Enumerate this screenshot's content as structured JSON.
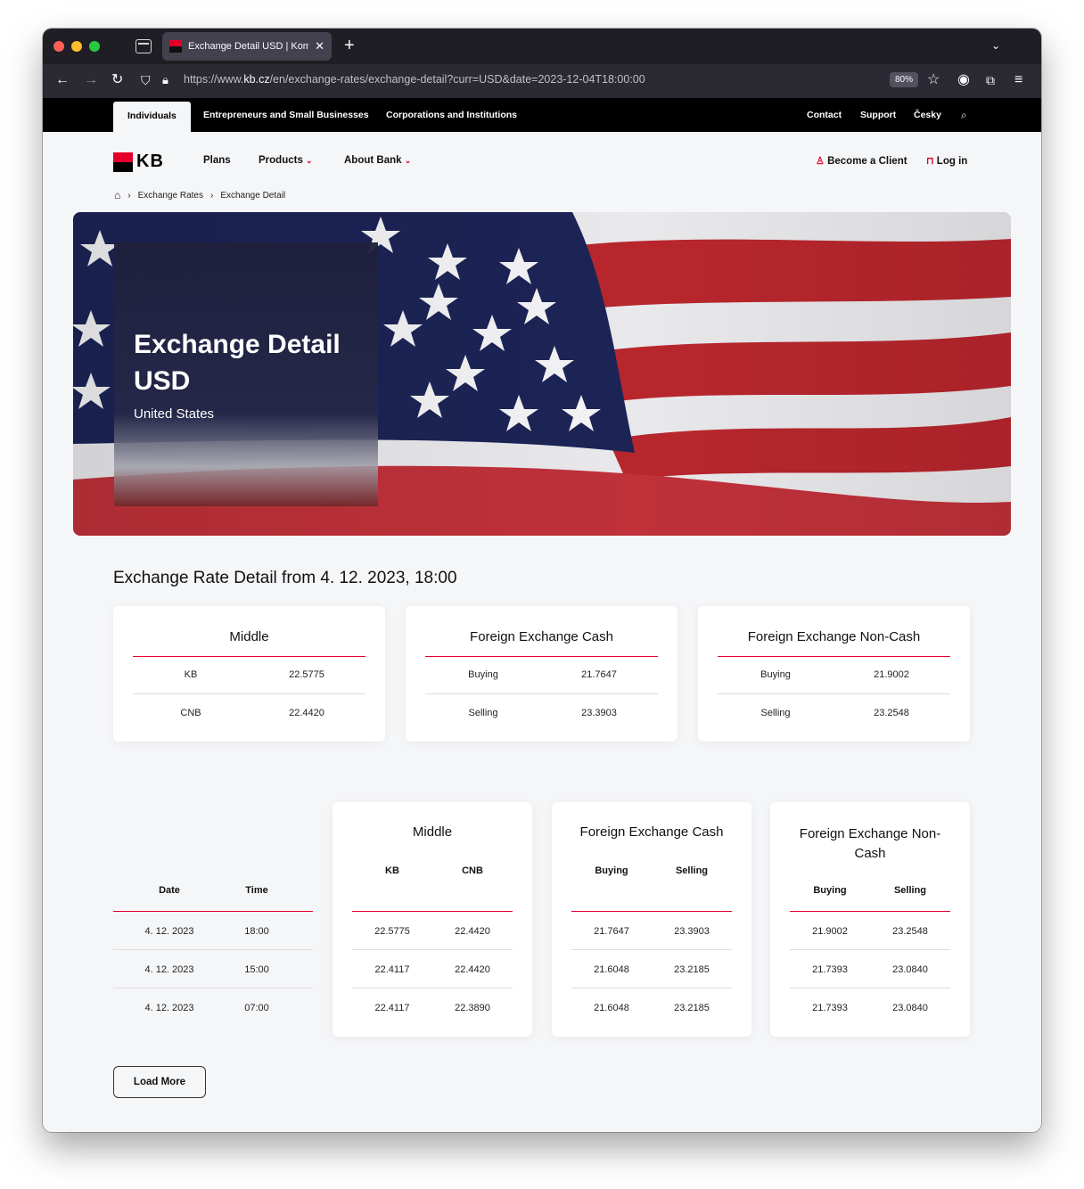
{
  "browser": {
    "tab_title": "Exchange Detail USD | Komerční",
    "url_prefix": "https://www.",
    "url_domain": "kb.cz",
    "url_path": "/en/exchange-rates/exchange-detail?curr=USD&date=2023-12-04T18:00:00",
    "zoom": "80%"
  },
  "topbar": {
    "segments": [
      "Individuals",
      "Entrepreneurs and Small Businesses",
      "Corporations and Institutions"
    ],
    "contact": "Contact",
    "support": "Support",
    "language": "Česky"
  },
  "header": {
    "logo": "KB",
    "plans": "Plans",
    "products": "Products",
    "about": "About Bank",
    "become_client": "Become a Client",
    "login": "Log in"
  },
  "breadcrumb": [
    "Exchange Rates",
    "Exchange Detail"
  ],
  "hero": {
    "title": "Exchange Detail USD",
    "subtitle": "United States"
  },
  "detail": {
    "title": "Exchange Rate Detail from 4. 12. 2023, 18:00",
    "middle": {
      "title": "Middle",
      "rows": [
        [
          "KB",
          "22.5775"
        ],
        [
          "CNB",
          "22.4420"
        ]
      ]
    },
    "cash": {
      "title": "Foreign Exchange Cash",
      "rows": [
        [
          "Buying",
          "21.7647"
        ],
        [
          "Selling",
          "23.3903"
        ]
      ]
    },
    "noncash": {
      "title": "Foreign Exchange Non-Cash",
      "rows": [
        [
          "Buying",
          "21.9002"
        ],
        [
          "Selling",
          "23.2548"
        ]
      ]
    }
  },
  "history": {
    "date_header": "Date",
    "time_header": "Time",
    "dates": [
      [
        "4. 12. 2023",
        "18:00"
      ],
      [
        "4. 12. 2023",
        "15:00"
      ],
      [
        "4. 12. 2023",
        "07:00"
      ]
    ],
    "middle": {
      "title": "Middle",
      "cols": [
        "KB",
        "CNB"
      ],
      "rows": [
        [
          "22.5775",
          "22.4420"
        ],
        [
          "22.4117",
          "22.4420"
        ],
        [
          "22.4117",
          "22.3890"
        ]
      ]
    },
    "cash": {
      "title": "Foreign Exchange Cash",
      "cols": [
        "Buying",
        "Selling"
      ],
      "rows": [
        [
          "21.7647",
          "23.3903"
        ],
        [
          "21.6048",
          "23.2185"
        ],
        [
          "21.6048",
          "23.2185"
        ]
      ]
    },
    "noncash": {
      "title_line1": "Foreign Exchange Non-",
      "title_line2": "Cash",
      "cols": [
        "Buying",
        "Selling"
      ],
      "rows": [
        [
          "21.9002",
          "23.2548"
        ],
        [
          "21.7393",
          "23.0840"
        ],
        [
          "21.7393",
          "23.0840"
        ]
      ]
    },
    "load_more": "Load More"
  },
  "colors": {
    "brand_red": "#e4002b",
    "chrome_dark": "#1f1e24",
    "toolbar": "#2b2a33"
  }
}
